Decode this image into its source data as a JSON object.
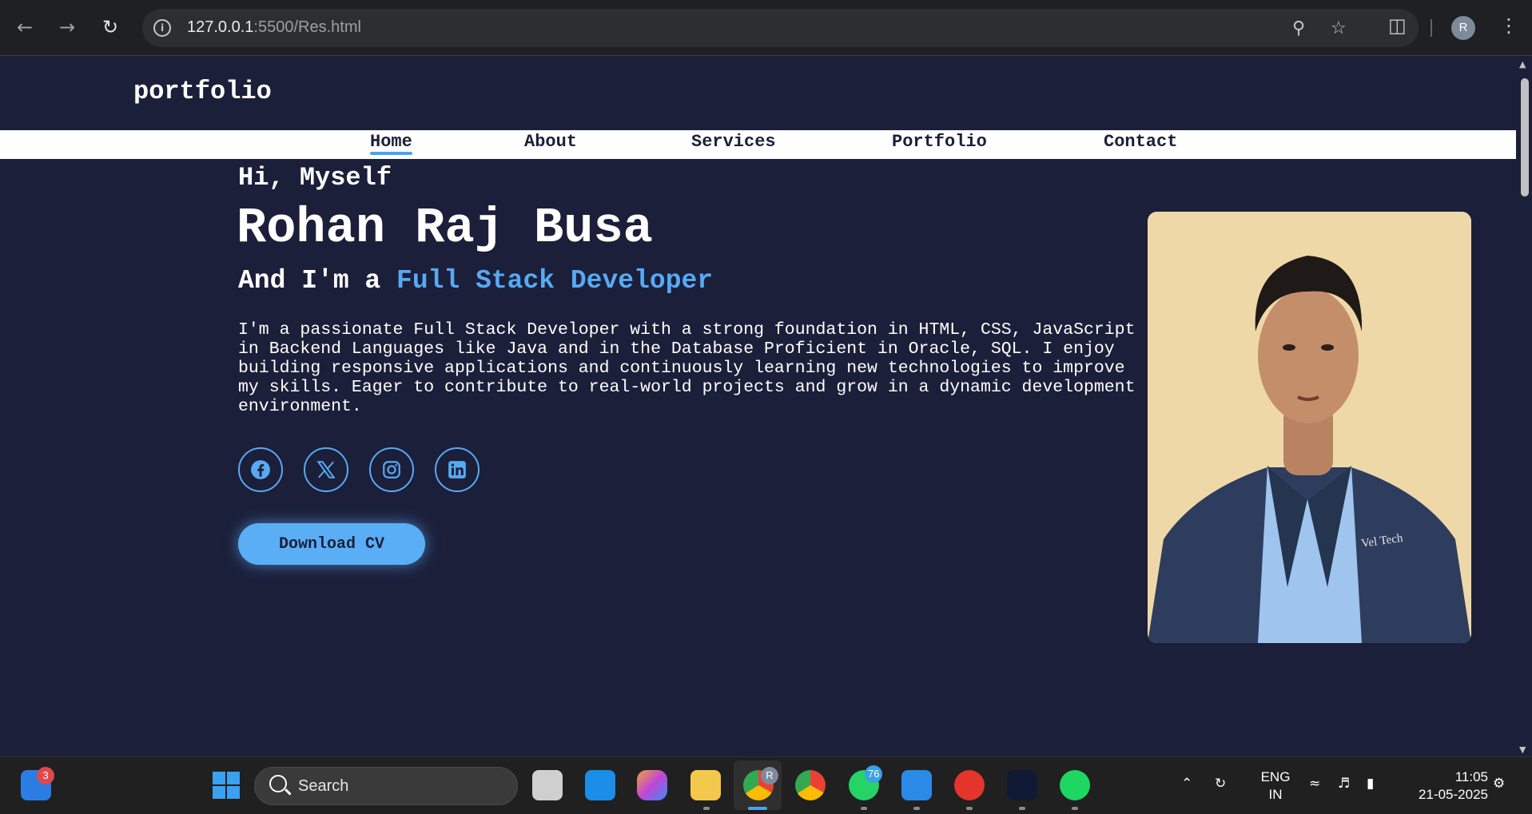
{
  "browser": {
    "url_host": "127.0.0.1",
    "url_rest": ":5500/Res.html",
    "profile_initial": "R"
  },
  "page": {
    "logo": "portfolio",
    "nav": [
      {
        "label": "Home",
        "active": true
      },
      {
        "label": "About"
      },
      {
        "label": "Services"
      },
      {
        "label": "Portfolio"
      },
      {
        "label": "Contact"
      }
    ],
    "greeting": "Hi, Myself",
    "name": "Rohan Raj Busa",
    "role_prefix": "And I'm a ",
    "role_highlight": "Full Stack Developer",
    "bio": "I'm a passionate Full Stack Developer with a strong foundation in HTML, CSS, JavaScript in Backend Languages like Java and in the Database Proficient in Oracle, SQL. I enjoy building responsive applications and continuously learning new technologies to improve my skills. Eager to contribute to real-world projects and grow in a dynamic development environment.",
    "socials": [
      "facebook-icon",
      "x-icon",
      "instagram-icon",
      "linkedin-icon"
    ],
    "cv_button": "Download CV",
    "accent_color": "#58a9f2",
    "background_color": "#1b1f3a"
  },
  "taskbar": {
    "search_placeholder": "Search",
    "widget_badge": "3",
    "whatsapp_badge": "76",
    "chrome_profile_badge": "R",
    "language_line1": "ENG",
    "language_line2": "IN",
    "time": "11:05",
    "date": "21-05-2025"
  }
}
